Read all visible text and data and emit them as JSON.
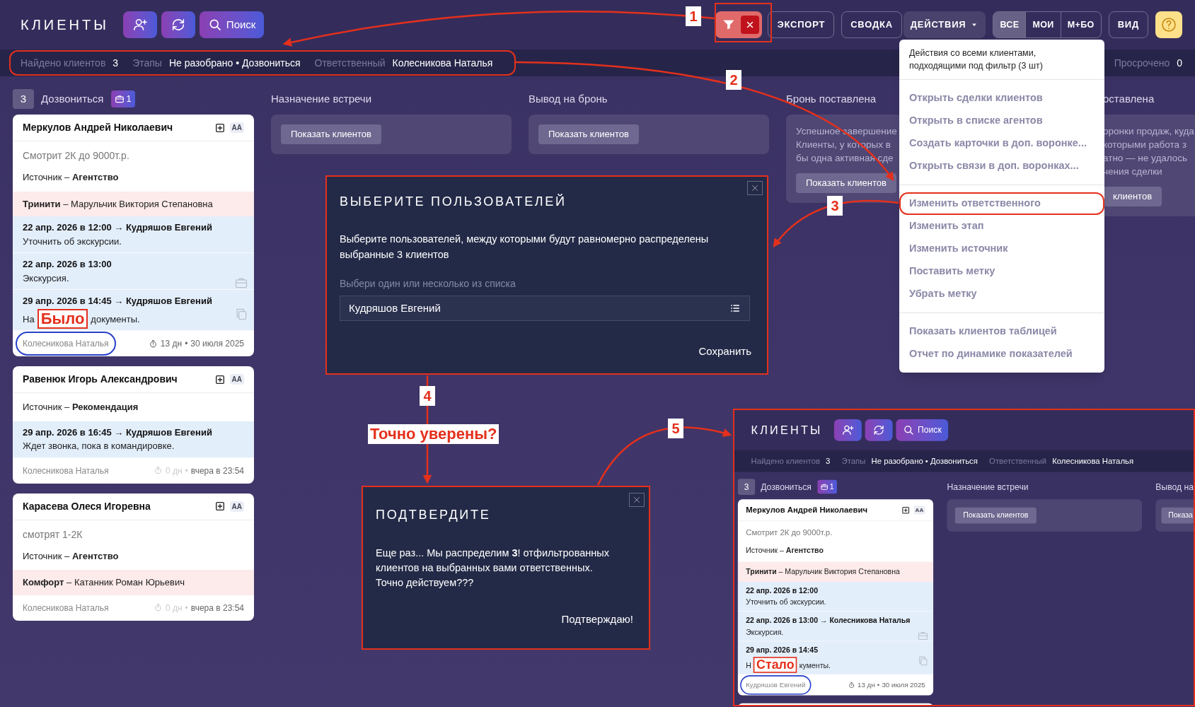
{
  "header": {
    "title": "КЛИЕНТЫ",
    "search_button": "Поиск",
    "filter_active": true,
    "buttons": [
      {
        "kind": "plain",
        "label": "ЭКСПОРТ"
      },
      {
        "kind": "plain",
        "label": "СВОДКА"
      },
      {
        "kind": "dropdown",
        "label": "ДЕЙСТВИЯ",
        "expanded": true
      }
    ],
    "scope_tabs": [
      {
        "label": "ВСЕ",
        "selected": true
      },
      {
        "label": "МОИ",
        "selected": false
      },
      {
        "label": "М+БО",
        "selected": false
      }
    ],
    "view_button": "ВИД"
  },
  "filter_bar": {
    "items": [
      {
        "label": "Найдено клиентов",
        "value": "3"
      },
      {
        "label": "Этапы",
        "value": "Не разобрано • Дозвониться"
      },
      {
        "label": "Ответственный",
        "value": "Колесникова Наталья"
      }
    ],
    "overdue": {
      "label": "Просрочено",
      "value": "0"
    }
  },
  "columns": [
    {
      "kind": "cards",
      "count": "3",
      "title": "Дозвониться",
      "deals_badge": "1",
      "cards": [
        {
          "name": "Меркулов Андрей Николаевич",
          "badge": "AA",
          "note": "Смотрит 2К до 9000т.р.",
          "source": "Источник – **Агентство**",
          "partner": "**Тринити** – Марульчик Виктория Степановна",
          "side_tools": true,
          "tasks": [
            {
              "title": "22 апр. 2026 в 12:00 → Кудряшов Евгений",
              "text_parts": [
                "Уточнить об экскурсии."
              ]
            },
            {
              "title": "22 апр. 2026 в 13:00",
              "text_parts": [
                "Экскурсия."
              ]
            },
            {
              "title": "29 апр. 2026 в 14:45 → Кудряшов Евгений",
              "text_parts": [
                "На",
                "документы."
              ]
            }
          ],
          "owner": "Колесникова Наталья",
          "owner_highlighted": true,
          "timer": "13 дн",
          "timer_muted": false,
          "separator": "•",
          "date": "30 июля 2025"
        },
        {
          "name": "Равенюк Игорь Александрович",
          "badge": "AA",
          "source": "Источник – **Рекомендация**",
          "side_tools": false,
          "tasks": [
            {
              "title": "29 апр. 2026 в 16:45 → Кудряшов Евгений",
              "text_parts": [
                "Ждет звонка, пока в командировке."
              ]
            }
          ],
          "owner": "Колесникова Наталья",
          "owner_highlighted": false,
          "timer": "0 дн",
          "timer_muted": true,
          "separator": "•",
          "date": "вчера в 23:54"
        },
        {
          "name": "Карасева Олеся Игоревна",
          "badge": "AA",
          "note": "смотрят 1-2К",
          "source": "Источник – **Агентство**",
          "partner": "**Комфорт** – Катанник Роман Юрьевич",
          "side_tools": false,
          "owner": "Колесникова Наталья",
          "owner_highlighted": false,
          "timer": "0 дн",
          "timer_muted": true,
          "separator": "•",
          "date": "вчера в 23:54"
        }
      ]
    },
    {
      "kind": "panel",
      "title": "Назначение встречи",
      "button": "Показать клиентов"
    },
    {
      "kind": "panel",
      "title": "Вывод на бронь",
      "button": "Показать клиентов"
    },
    {
      "kind": "panel",
      "title": "Бронь поставлена",
      "description_lines": [
        "Успешное завершение",
        "Клиенты, у которых в",
        "бы одна активная сде"
      ],
      "button": "Показать клиентов"
    },
    {
      "kind": "hidden_left",
      "title": "оставлена",
      "description_lines": [
        "оронки продаж, куда",
        "которыми работа з",
        "атно — не удалось",
        "чения сделки"
      ],
      "button": "клиентов"
    }
  ],
  "actions_menu": {
    "heading": "Действия со всеми клиентами, подходящими под фильтр (3 шт)",
    "groups": [
      [
        {
          "label": "Открыть сделки клиентов",
          "highlighted": false
        },
        {
          "label": "Открыть в списке агентов",
          "highlighted": false
        },
        {
          "label": "Создать карточки в доп. воронке...",
          "highlighted": false
        },
        {
          "label": "Открыть связи в доп. воронках...",
          "highlighted": false
        }
      ],
      [
        {
          "label": "Изменить ответственного",
          "highlighted": true
        },
        {
          "label": "Изменить этап",
          "highlighted": false
        },
        {
          "label": "Изменить источник",
          "highlighted": false
        },
        {
          "label": "Поставить метку",
          "highlighted": false
        },
        {
          "label": "Убрать метку",
          "highlighted": false
        }
      ],
      [
        {
          "label": "Показать клиентов таблицей",
          "highlighted": false
        },
        {
          "label": "Отчет по динамике показателей",
          "highlighted": false
        }
      ]
    ]
  },
  "assign_dialog": {
    "title": "ВЫБЕРИТЕ ПОЛЬЗОВАТЕЛЕЙ",
    "text": "Выберите пользователей, между которыми будут равномерно распределены выбранные 3 клиентов",
    "field_label": "Выбери один или несколько из списка",
    "field_value": "Кудряшов Евгений",
    "save_button": "Сохранить"
  },
  "confirm_dialog": {
    "title": "ПОДТВЕРДИТЕ",
    "text": "Еще раз... Мы распределим **3**! отфильтрованных клиентов на выбранных вами ответственных. Точно действуем???",
    "confirm_button": "Подтверждаю!"
  },
  "annotations": {
    "steps": [
      "1",
      "2",
      "3",
      "4",
      "5"
    ],
    "question": "Точно уверены?",
    "before_label": "Было",
    "after_label": "Стало"
  },
  "result_screenshot": {
    "header": {
      "title": "КЛИЕНТЫ",
      "search_button": "Поиск"
    },
    "filter_bar": {
      "items": [
        {
          "label": "Найдено клиентов",
          "value": "3"
        },
        {
          "label": "Этапы",
          "value": "Не разобрано • Дозвониться"
        },
        {
          "label": "Ответственный",
          "value": "Колесникова Наталья"
        }
      ]
    },
    "columns": [
      {
        "kind": "cards",
        "count": "3",
        "title": "Дозвониться",
        "deals_badge": "1",
        "cards": [
          {
            "name": "Меркулов Андрей Николаевич",
            "badge": "AA",
            "note": "Смотрит 2К до 9000т.р.",
            "source": "Источник – **Агентство**",
            "partner": "**Тринити** – Марульчик Виктория Степановна",
            "side_tools": true,
            "tasks": [
              {
                "title": "22 апр. 2026 в 12:00",
                "text_parts": [
                  "Уточнить об экскурсии."
                ]
              },
              {
                "title": "22 апр. 2026 в 13:00 → Колесникова Наталья",
                "text_parts": [
                  "Экскурсия."
                ]
              },
              {
                "title": "29 апр. 2026 в 14:45",
                "text_parts": [
                  "Н",
                  "кументы."
                ]
              }
            ],
            "owner": "Кудряшов Евгений",
            "owner_highlighted": true,
            "timer": "13 дн",
            "timer_muted": false,
            "separator": "•",
            "date": "30 июля 2025"
          }
        ]
      },
      {
        "kind": "panel",
        "title": "Назначение встречи",
        "button": "Показать клиентов"
      },
      {
        "kind": "cut",
        "title": "Вывод на",
        "button": "Показа"
      }
    ]
  }
}
